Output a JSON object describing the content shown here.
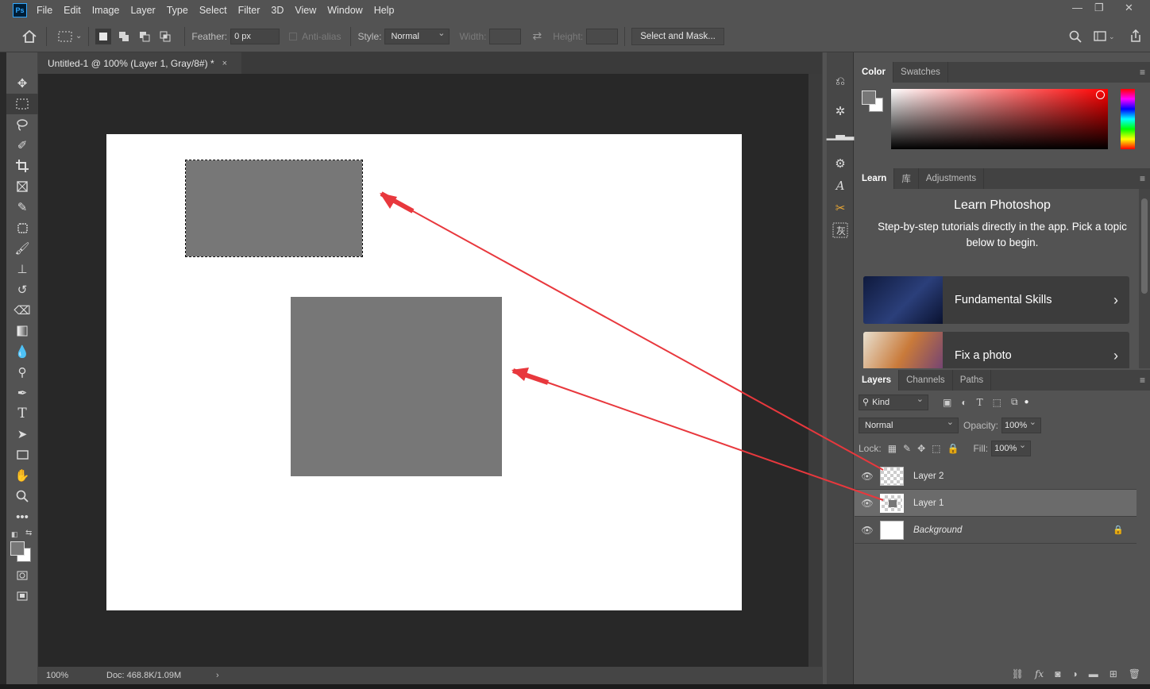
{
  "app": {
    "logo": "Ps"
  },
  "menu": [
    "File",
    "Edit",
    "Image",
    "Layer",
    "Type",
    "Select",
    "Filter",
    "3D",
    "View",
    "Window",
    "Help"
  ],
  "window_controls": {
    "minimize": "—",
    "restore": "❐",
    "close": "✕"
  },
  "options": {
    "feather_label": "Feather:",
    "feather_value": "0 px",
    "antialias_label": "Anti-alias",
    "style_label": "Style:",
    "style_value": "Normal",
    "width_label": "Width:",
    "height_label": "Height:",
    "select_mask_label": "Select and Mask..."
  },
  "document": {
    "tab_title": "Untitled-1 @ 100% (Layer 1, Gray/8#) *",
    "close": "×",
    "zoom": "100%",
    "doc_info": "Doc: 468.8K/1.09M",
    "status_arrow": "›"
  },
  "color_panel": {
    "tabs": [
      "Color",
      "Swatches"
    ]
  },
  "learn_panel": {
    "tabs": [
      "Learn",
      "库",
      "Adjustments"
    ],
    "title": "Learn Photoshop",
    "subtitle": "Step-by-step tutorials directly in the app. Pick a topic below to begin.",
    "cards": [
      {
        "label": "Fundamental Skills"
      },
      {
        "label": "Fix a photo"
      }
    ]
  },
  "layers_panel": {
    "tabs": [
      "Layers",
      "Channels",
      "Paths"
    ],
    "filter_kind": "Kind",
    "blend_mode": "Normal",
    "opacity_label": "Opacity:",
    "opacity_value": "100%",
    "lock_label": "Lock:",
    "fill_label": "Fill:",
    "fill_value": "100%",
    "layers": [
      {
        "name": "Layer 2",
        "selected": false
      },
      {
        "name": "Layer 1",
        "selected": true
      },
      {
        "name": "Background",
        "selected": false
      }
    ]
  },
  "colors": {
    "accent_arrow": "#e8383d",
    "shape_gray": "#777777",
    "ps_blue": "#31a8ff"
  }
}
